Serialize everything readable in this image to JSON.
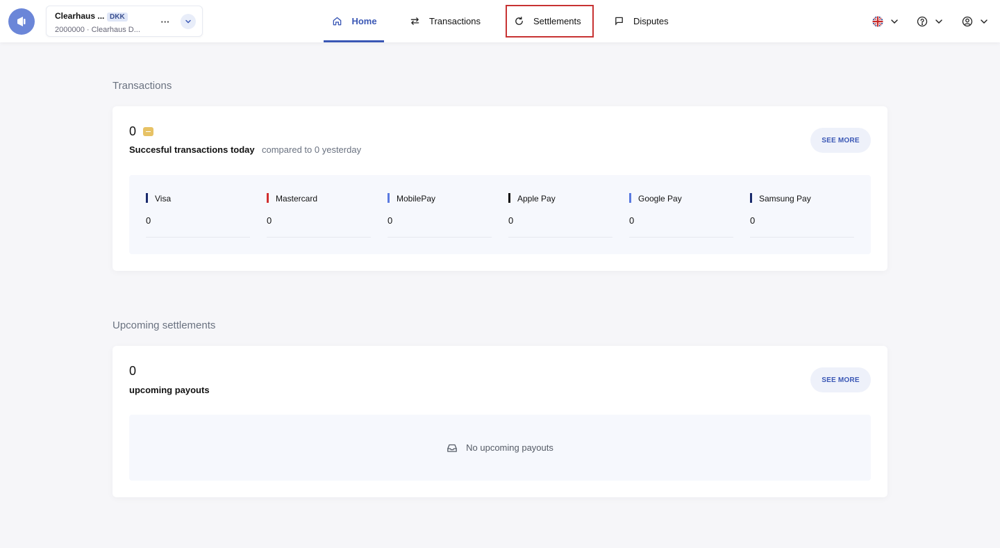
{
  "header": {
    "merchant": {
      "name": "Clearhaus ...",
      "currency": "DKK",
      "subtitle": "2000000 · Clearhaus D...",
      "more_label": "···"
    },
    "nav": {
      "home": "Home",
      "transactions": "Transactions",
      "settlements": "Settlements",
      "disputes": "Disputes"
    },
    "icons": {
      "logo": "app-logo",
      "language": "uk-flag-icon",
      "help": "question-icon",
      "user": "user-circle-icon"
    }
  },
  "transactions": {
    "section_title": "Transactions",
    "count": "0",
    "label": "Succesful transactions today",
    "compare": "compared to 0 yesterday",
    "see_more": "SEE MORE",
    "methods": [
      {
        "name": "Visa",
        "value": "0",
        "color": "#1a2b6d"
      },
      {
        "name": "Mastercard",
        "value": "0",
        "color": "#d12f2f"
      },
      {
        "name": "MobilePay",
        "value": "0",
        "color": "#5a7ae0"
      },
      {
        "name": "Apple Pay",
        "value": "0",
        "color": "#111111"
      },
      {
        "name": "Google Pay",
        "value": "0",
        "color": "#5a7ae0"
      },
      {
        "name": "Samsung Pay",
        "value": "0",
        "color": "#1a2b6d"
      }
    ]
  },
  "settlements": {
    "section_title": "Upcoming settlements",
    "count": "0",
    "label": "upcoming payouts",
    "see_more": "SEE MORE",
    "empty_message": "No upcoming payouts"
  }
}
